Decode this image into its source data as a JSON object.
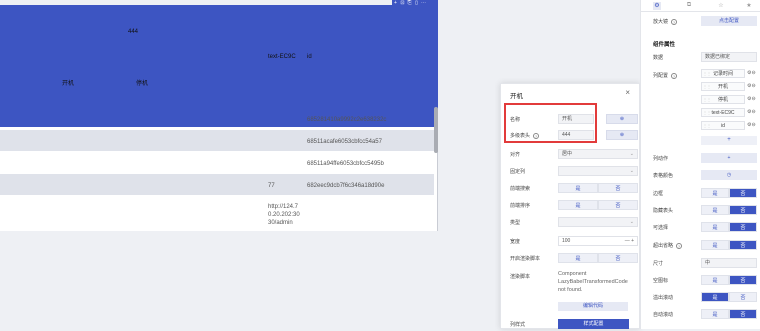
{
  "table": {
    "headers": {
      "h444": "444",
      "kaiji": "开机",
      "tingji": "停机",
      "textcol": "text-EC9C",
      "id": "id"
    },
    "rows": [
      {
        "text": "",
        "id": "685281410a9992c2e638232c"
      },
      {
        "text": "",
        "id": "68511acafe6053cbfcc54a57"
      },
      {
        "text": "",
        "id": "68511a94ffe6053cbfcc5495b"
      },
      {
        "text": "77",
        "id": "682eec9dcb7f6c346a18d90e"
      },
      {
        "text": "http://124.70.20.202:3030/admin",
        "id": ""
      }
    ],
    "toolbar_icons": [
      "+",
      "⊡",
      "⎘",
      "▯",
      "⋯"
    ]
  },
  "modal": {
    "title": "开机",
    "close": "×",
    "fields": {
      "name_label": "名称",
      "name_value": "开机",
      "multi_label": "多级表头",
      "multi_value": "444",
      "align_label": "对齐",
      "align_value": "居中",
      "fixed_label": "固定列",
      "fixed_value": "",
      "search_label": "前端搜索",
      "sort_label": "前端排序",
      "type_label": "类型",
      "type_value": "",
      "width_label": "宽度",
      "width_value": "100",
      "render_label": "开启渲染脚本",
      "script_label": "渲染脚本",
      "style_label": "列样式"
    },
    "seg_yes": "是",
    "seg_no": "否",
    "error_text": "Component LazyBabelTransformedCode not found.",
    "edit_code": "编辑代码",
    "style_btn": "样式配置",
    "width_ctl": "—  +"
  },
  "panel": {
    "tabs": [
      "⚙",
      "⧉",
      "☆",
      "★"
    ],
    "zoom_label": "放大镜",
    "zoom_btn": "点击配置",
    "section_table": "组件属性",
    "data_label": "数据",
    "data_value": "数据已绑定",
    "cols_label": "列配置",
    "columns": [
      "记录时间",
      "开机",
      "停机",
      "text-EC9C",
      "id"
    ],
    "add": "+",
    "actions_label": "列动作",
    "color_label": "表格颜色",
    "border_label": "边框",
    "hide_header_label": "隐藏表头",
    "selectable_label": "可选择",
    "ellipsis_label": "超出省略",
    "size_label": "尺寸",
    "size_value": "中",
    "empty_label": "空图标",
    "scroll_label": "溢出滚动",
    "autoscroll_label": "自动滚动",
    "yes": "是",
    "no": "否"
  },
  "colors": {
    "accent": "#3d55c2",
    "highlight": "#e23b3b"
  }
}
